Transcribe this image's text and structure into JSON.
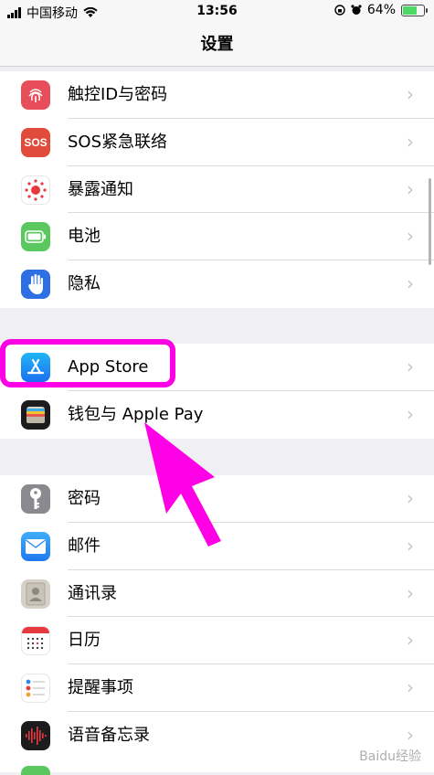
{
  "status_bar": {
    "carrier": "中国移动",
    "time": "13:56",
    "battery": "64%",
    "battery_level": 0.64
  },
  "nav": {
    "title": "设置"
  },
  "groups": [
    {
      "items": [
        {
          "label": "触控ID与密码",
          "icon": "fingerprint-icon",
          "color": "#e84e5a"
        },
        {
          "label": "SOS紧急联络",
          "icon": "sos-icon",
          "color": "#e14b3b"
        },
        {
          "label": "暴露通知",
          "icon": "exposure-icon",
          "color": "#ffffff"
        },
        {
          "label": "电池",
          "icon": "battery-icon",
          "color": "#5bc85f"
        },
        {
          "label": "隐私",
          "icon": "hand-icon",
          "color": "#2e6fe3"
        }
      ]
    },
    {
      "items": [
        {
          "label": "App Store",
          "icon": "app-store-icon",
          "color": "#1a8cf0"
        },
        {
          "label": "钱包与 Apple Pay",
          "icon": "wallet-icon",
          "color": "#1c1c1e"
        }
      ]
    },
    {
      "items": [
        {
          "label": "密码",
          "icon": "key-icon",
          "color": "#8a8a8e"
        },
        {
          "label": "邮件",
          "icon": "mail-icon",
          "color": "#2b8af1"
        },
        {
          "label": "通讯录",
          "icon": "contacts-icon",
          "color": "#c9c3b9"
        },
        {
          "label": "日历",
          "icon": "calendar-icon",
          "color": "#ffffff"
        },
        {
          "label": "提醒事项",
          "icon": "reminders-icon",
          "color": "#ffffff"
        },
        {
          "label": "语音备忘录",
          "icon": "voice-memo-icon",
          "color": "#1c1c1e"
        }
      ]
    }
  ],
  "watermark": "Baidu经验",
  "chevron": "›"
}
